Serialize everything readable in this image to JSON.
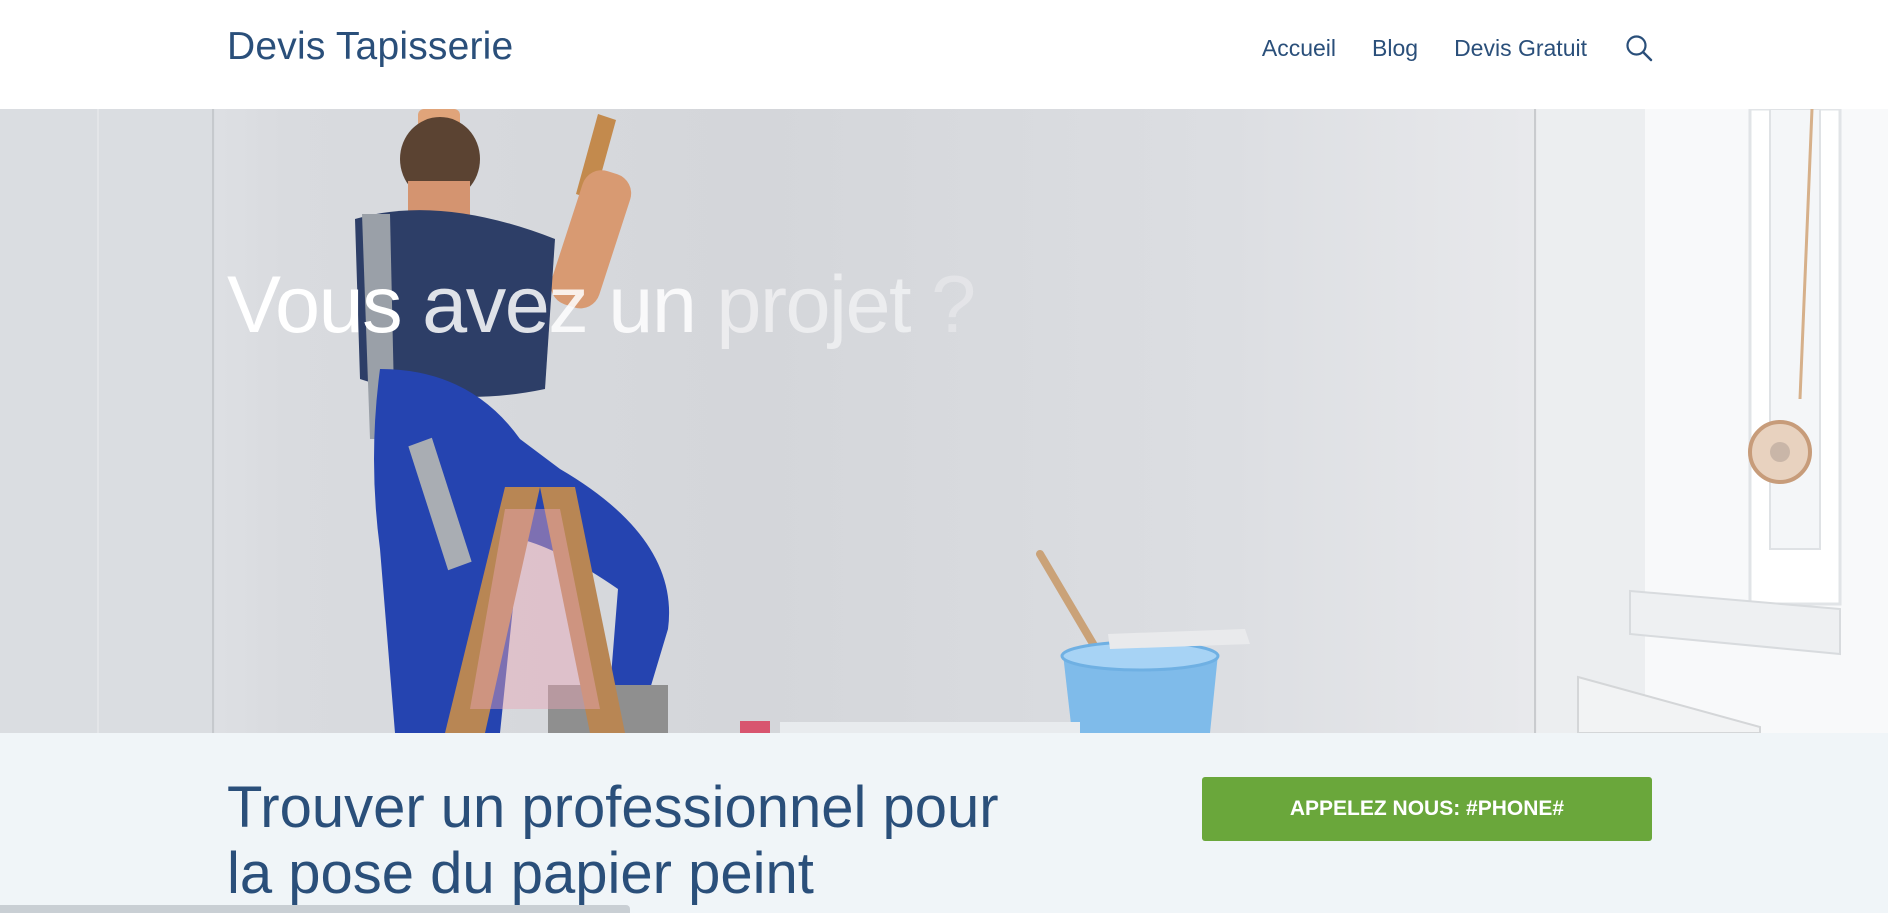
{
  "header": {
    "site_title": "Devis Tapisserie",
    "nav": [
      "Accueil",
      "Blog",
      "Devis Gratuit"
    ],
    "search_icon": "search-icon"
  },
  "hero": {
    "heading_words": [
      "Vous",
      "avez",
      "un",
      "projet",
      "?"
    ],
    "image_alt": "wallpaper-installer-on-ladder"
  },
  "band": {
    "title": "Trouver un professionnel pour la pose du papier peint",
    "call_button": "APPELEZ NOUS: #PHONE#"
  },
  "colors": {
    "brand_blue": "#2a4f7a",
    "button_green": "#6aa73b",
    "band_background": "#f0f5f8"
  }
}
